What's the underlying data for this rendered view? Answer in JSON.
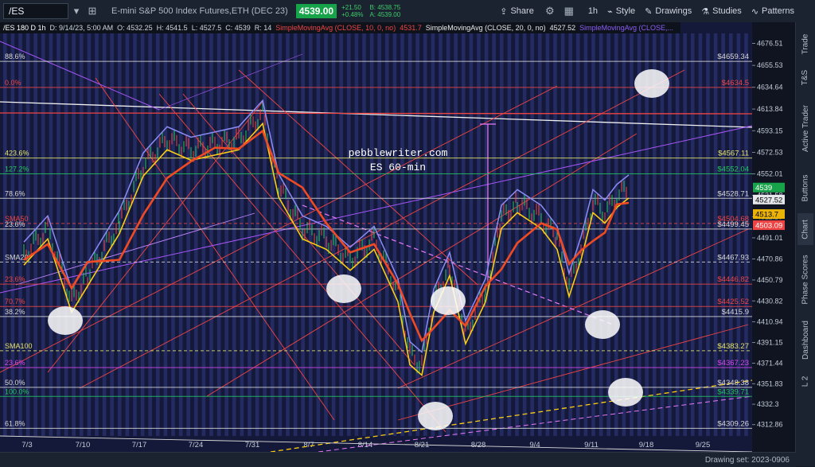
{
  "toolbar": {
    "symbol": "/ES",
    "instrument": "E-mini S&P 500 Index Futures,ETH (DEC 23)",
    "last": "4539.00",
    "change": "+21.50",
    "change_pct": "+0.48%",
    "bid": "B: 4538.75",
    "ask": "A: 4539.00",
    "share": "Share",
    "timeframe": "1h",
    "style": "Style",
    "drawings": "Drawings",
    "studies": "Studies",
    "patterns": "Patterns"
  },
  "studybar": {
    "label": "/ES 180 D 1h",
    "date": "D: 9/14/23, 5:00 AM",
    "open": "O: 4532.25",
    "high": "H: 4541.5",
    "low": "L: 4527.5",
    "close": "C: 4539",
    "range": "R: 14",
    "sma1": "SimpleMovingAvg (CLOSE, 10, 0, no)",
    "sma1v": "4531.7",
    "sma2": "SimpleMovingAvg (CLOSE, 20, 0, no)",
    "sma2v": "4527.52",
    "sma3": "SimpleMovingAvg (CLOSE,...",
    "colors": {
      "sma10": "#ef4444",
      "sma20": "#e7e7e7",
      "sma3": "#8b5cf6"
    }
  },
  "chart": {
    "watermark1": "pebblewriter.com",
    "watermark2": "ES 60-min",
    "price_ticks": [
      "4676.51",
      "4655.53",
      "4634.64",
      "4613.84",
      "4593.15",
      "4572.53",
      "4552.01",
      "4531.58",
      "4511.20",
      "4491.01",
      "4470.86",
      "4450.79",
      "4430.82",
      "4410.94",
      "4391.15",
      "4371.44",
      "4351.83",
      "4332.3",
      "4312.86"
    ],
    "date_ticks": [
      "7/3",
      "7/10",
      "7/17",
      "7/24",
      "7/31",
      "8/7",
      "8/14",
      "8/21",
      "8/28",
      "9/4",
      "9/11",
      "9/18",
      "9/25"
    ],
    "levels": [
      {
        "left": "88.6%",
        "right": "$4659.34",
        "price": 4659.34,
        "color": "#d9d9d9",
        "dash": false
      },
      {
        "left": "0.0%",
        "right": "$4634.5",
        "price": 4634.5,
        "color": "#ef4444",
        "dash": false
      },
      {
        "left": "423.6%",
        "right": "$4567.11",
        "price": 4567.11,
        "color": "#e5e56b",
        "dash": false
      },
      {
        "left": "127.2%",
        "right": "$4552.04",
        "price": 4552.04,
        "color": "#22c55e",
        "dash": false
      },
      {
        "left": "78.6%",
        "right": "$4528.71",
        "price": 4528.71,
        "color": "#d9d9d9",
        "dash": false
      },
      {
        "left": "SMA50",
        "right": "$4504.68",
        "price": 4504.68,
        "color": "#ef4444",
        "dash": true
      },
      {
        "left": "23.6%",
        "right": "$4499.45",
        "price": 4499.45,
        "color": "#d9d9d9",
        "dash": false
      },
      {
        "left": "SMA20",
        "right": "$4467.93",
        "price": 4467.93,
        "color": "#d9d9d9",
        "dash": true
      },
      {
        "left": "23.6%",
        "right": "$4446.82",
        "price": 4446.82,
        "color": "#ef4444",
        "dash": false
      },
      {
        "left": "70.7%",
        "right": "$4425.52",
        "price": 4425.52,
        "color": "#ef4444",
        "dash": false
      },
      {
        "left": "38.2%",
        "right": "$4415.9",
        "price": 4415.9,
        "color": "#d9d9d9",
        "dash": false
      },
      {
        "left": "SMA100",
        "right": "$4383.27",
        "price": 4383.27,
        "color": "#e5e56b",
        "dash": true
      },
      {
        "left": "23.6%",
        "right": "$4367.23",
        "price": 4367.23,
        "color": "#d946ef",
        "dash": false
      },
      {
        "left": "50.0%",
        "right": "$4348.38",
        "price": 4348.38,
        "color": "#d9d9d9",
        "dash": false
      },
      {
        "left": "100.0%",
        "right": "$4339.71",
        "price": 4339.71,
        "color": "#22c55e",
        "dash": false
      },
      {
        "left": "61.8%",
        "right": "$4309.26",
        "price": 4309.26,
        "color": "#d9d9d9",
        "dash": false
      }
    ],
    "price_labels": [
      {
        "text": "4539",
        "price": 4539,
        "color": "#16a34a"
      },
      {
        "text": "4527.52",
        "price": 4527.52,
        "color": "#e5e7eb"
      },
      {
        "text": "4513.7",
        "price": 4513.7,
        "color": "#eab308"
      },
      {
        "text": "4503.09",
        "price": 4503.09,
        "color": "#ef4444"
      }
    ]
  },
  "sidebar": {
    "tabs": [
      "Trade",
      "T&S",
      "Active Trader",
      "Buttons",
      "Chart",
      "Phase Scores",
      "Dashboard",
      "L 2"
    ]
  },
  "status": {
    "drawing_set": "Drawing set: 2023-0906"
  }
}
